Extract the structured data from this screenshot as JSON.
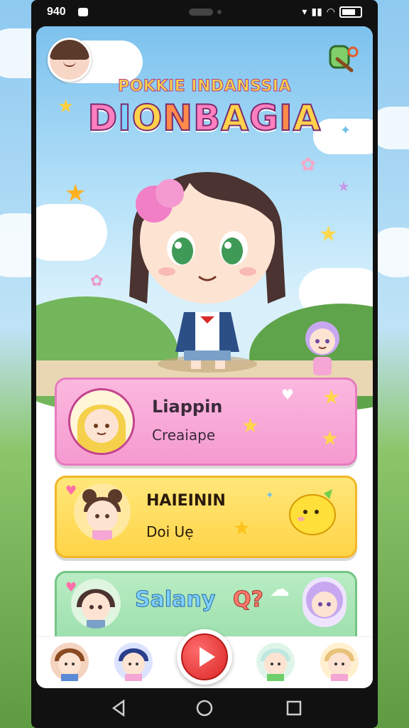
{
  "status_bar": {
    "time": "940",
    "icons": [
      "notification-icon",
      "signal-icon",
      "wifi-icon",
      "battery-icon"
    ]
  },
  "header": {
    "logo_subtitle": "POKKIE INDANSSIA",
    "logo_title": "DIONBAGIA",
    "settings_icon": "key-icon"
  },
  "cards": [
    {
      "title": "Liappin",
      "subtitle": "Creaiape",
      "color": "#f59ad0"
    },
    {
      "title": "HAIEININ",
      "subtitle": "Doi Uẹ",
      "color": "#ffd447"
    },
    {
      "title": "Salany",
      "badge": "Q?",
      "color": "#9bdfac"
    }
  ],
  "bottom_nav": {
    "items": [
      "character-1",
      "character-2",
      "play",
      "character-3",
      "character-4"
    ],
    "play_icon": "play-icon"
  },
  "system_nav": [
    "back-icon",
    "home-icon",
    "recents-icon"
  ],
  "colors": {
    "accent_pink": "#f59ad0",
    "accent_yellow": "#ffd447",
    "accent_green": "#9bdfac",
    "play_red": "#d92525"
  }
}
